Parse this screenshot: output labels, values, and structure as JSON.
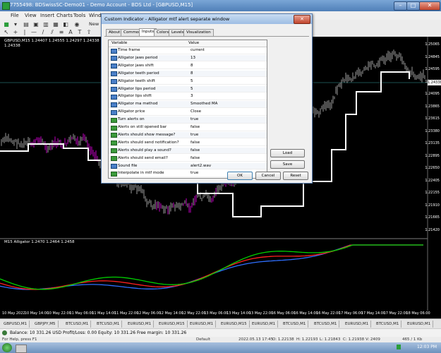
{
  "window": {
    "title": "7755498: BDSwissSC-Demo01 - Demo Account - BDS Ltd - [GBPUSD,M15]",
    "minimize": "–",
    "maximize": "□",
    "close": "✕"
  },
  "menu": [
    "File",
    "View",
    "Insert",
    "Charts",
    "Tools",
    "Wind"
  ],
  "toolbar": {
    "new_order": "New"
  },
  "chart": {
    "symbol_header": "GBPUSD,M15  1.24407 1.24555 1.24297 1.24338",
    "symbol_sub": "1.24338",
    "indicator_header": "M15   Alligator 1.2470 1.2464 1.2458",
    "price_labels": [
      "1.25065",
      "1.24845",
      "1.24595",
      "1.24338",
      "1.24095",
      "1.23865",
      "1.23615",
      "1.23380",
      "1.23135",
      "1.22895",
      "1.22650",
      "1.22405",
      "1.22155",
      "1.21910",
      "1.21665",
      "1.21420"
    ],
    "current_price": "1.24338",
    "date_labels": [
      "10 May 2022",
      "10 May 14:00",
      "10 May 22:00",
      "11 May 06:00",
      "11 May 14:00",
      "11 May 22:00",
      "12 May 06:00",
      "12 May 14:00",
      "12 May 22:00",
      "13 May 06:00",
      "13 May 14:00",
      "13 May 22:00",
      "16 May 06:00",
      "16 May 14:00",
      "16 May 22:00",
      "17 May 06:00",
      "17 May 14:00",
      "17 May 22:00",
      "18 May 06:00"
    ],
    "colors": {
      "price_line": "#ffffff",
      "bars": "#9a9a9a",
      "magenta": "#c000c0",
      "jaw": "#2f6fff",
      "teeth": "#ff2020",
      "lips": "#00d000"
    }
  },
  "tabs": [
    "GBPUSD,M1",
    "GBPJPY,M5",
    "BTCUSD,M1",
    "BTCUSD,M1",
    "EURUSD,M1",
    "EURUSD,M15",
    "EURUSD,M1",
    "EURUSD,M15",
    "EURUSD,M1",
    "BTCUSD,M1",
    "BTCUSD,M1",
    "EURUSD,M1",
    "BTCUSD,M1",
    "EURUSD,M1"
  ],
  "balance": {
    "text": "Balance: 10 331.26 USD  Profit/Loss: 0.00  Equity: 10 331.26  Free margin: 10 331.26"
  },
  "statusbar": {
    "left": "For Help, press F1",
    "profile": "Default",
    "datetime": "2022.05.13 17:45",
    "o": "O: 1.22138",
    "h": "H: 1.22193",
    "l": "L: 1.21843",
    "c": "C: 1.21938",
    "v": "V: 2409",
    "traffic": "465 / 1 Kb"
  },
  "taskbar": {
    "time": "12:03 PM"
  },
  "dialog": {
    "title": "Custom Indicator - Alligator mtf alert separate window",
    "close": "✕",
    "tabs": [
      "About",
      "Common",
      "Inputs",
      "Colors",
      "Levels",
      "Visualization"
    ],
    "active_tab": "Inputs",
    "col_variable": "Variable",
    "col_value": "Value",
    "rows": [
      {
        "name": "Time frame",
        "value": "current",
        "icon": "blue"
      },
      {
        "name": "Alligator jaws period",
        "value": "13",
        "icon": "blue"
      },
      {
        "name": "Alligator jaws shift",
        "value": "8",
        "icon": "blue"
      },
      {
        "name": "Alligator teeth period",
        "value": "8",
        "icon": "blue"
      },
      {
        "name": "Alligator teeth shift",
        "value": "5",
        "icon": "blue"
      },
      {
        "name": "Alligator lips period",
        "value": "5",
        "icon": "blue"
      },
      {
        "name": "Alligator lips shift",
        "value": "3",
        "icon": "blue"
      },
      {
        "name": "Alligator ma method",
        "value": "Smoothed MA",
        "icon": "blue"
      },
      {
        "name": "Alligator price",
        "value": "Close",
        "icon": "blue"
      },
      {
        "name": "Turn alerts on",
        "value": "true",
        "icon": "green"
      },
      {
        "name": "Alerts on still opened bar",
        "value": "false",
        "icon": "green"
      },
      {
        "name": "Alerts should show message?",
        "value": "true",
        "icon": "green"
      },
      {
        "name": "Alerts should send notification?",
        "value": "false",
        "icon": "green"
      },
      {
        "name": "Alerts should play a sound?",
        "value": "false",
        "icon": "green"
      },
      {
        "name": "Alerts should send email?",
        "value": "false",
        "icon": "green"
      },
      {
        "name": "Sound file",
        "value": "alert2.wav",
        "icon": "blue"
      },
      {
        "name": "Interpolate in mtf mode",
        "value": "true",
        "icon": "green"
      }
    ],
    "load_btn": "Load",
    "save_btn": "Save",
    "ok_btn": "OK",
    "cancel_btn": "Cancel",
    "reset_btn": "Reset"
  }
}
